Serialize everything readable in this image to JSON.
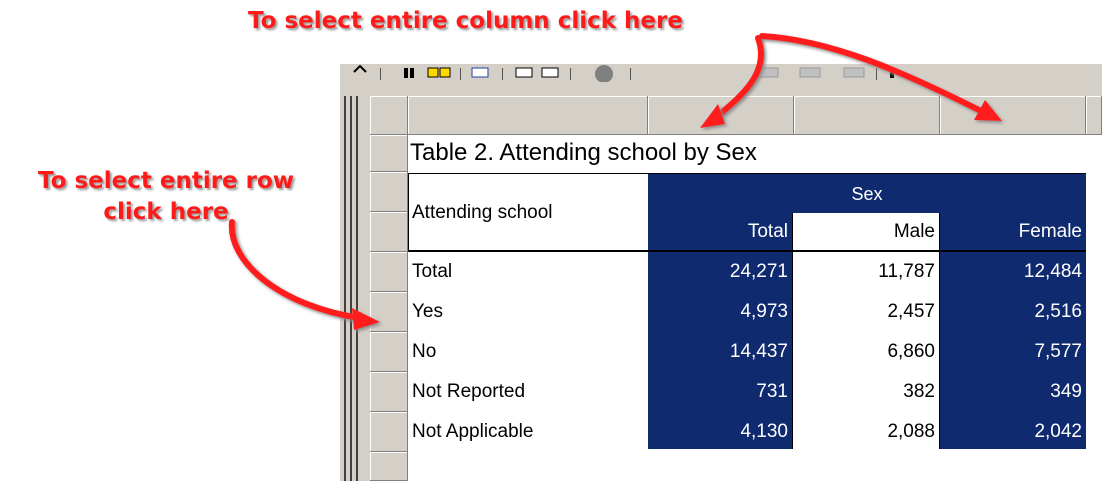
{
  "annotations": {
    "column_hint": "To select entire column click here",
    "row_hint_line1": "To select entire row",
    "row_hint_line2": "click here"
  },
  "table": {
    "title": "Table 2. Attending school by Sex",
    "row_header_label": "Attending school",
    "group_label": "Sex",
    "columns": [
      "Total",
      "Male",
      "Female"
    ],
    "rows": [
      {
        "label": "Total",
        "values": [
          "24,271",
          "11,787",
          "12,484"
        ]
      },
      {
        "label": "Yes",
        "values": [
          "4,973",
          "2,457",
          "2,516"
        ]
      },
      {
        "label": "No",
        "values": [
          "14,437",
          "6,860",
          "7,577"
        ]
      },
      {
        "label": "Not Reported",
        "values": [
          "731",
          "382",
          "349"
        ]
      },
      {
        "label": "Not Applicable",
        "values": [
          "4,130",
          "2,088",
          "2,042"
        ]
      }
    ]
  },
  "colors": {
    "annotation_red": "#ff1a1a",
    "selection_navy": "#0f2a6e",
    "chrome_gray": "#d4d0c8"
  }
}
